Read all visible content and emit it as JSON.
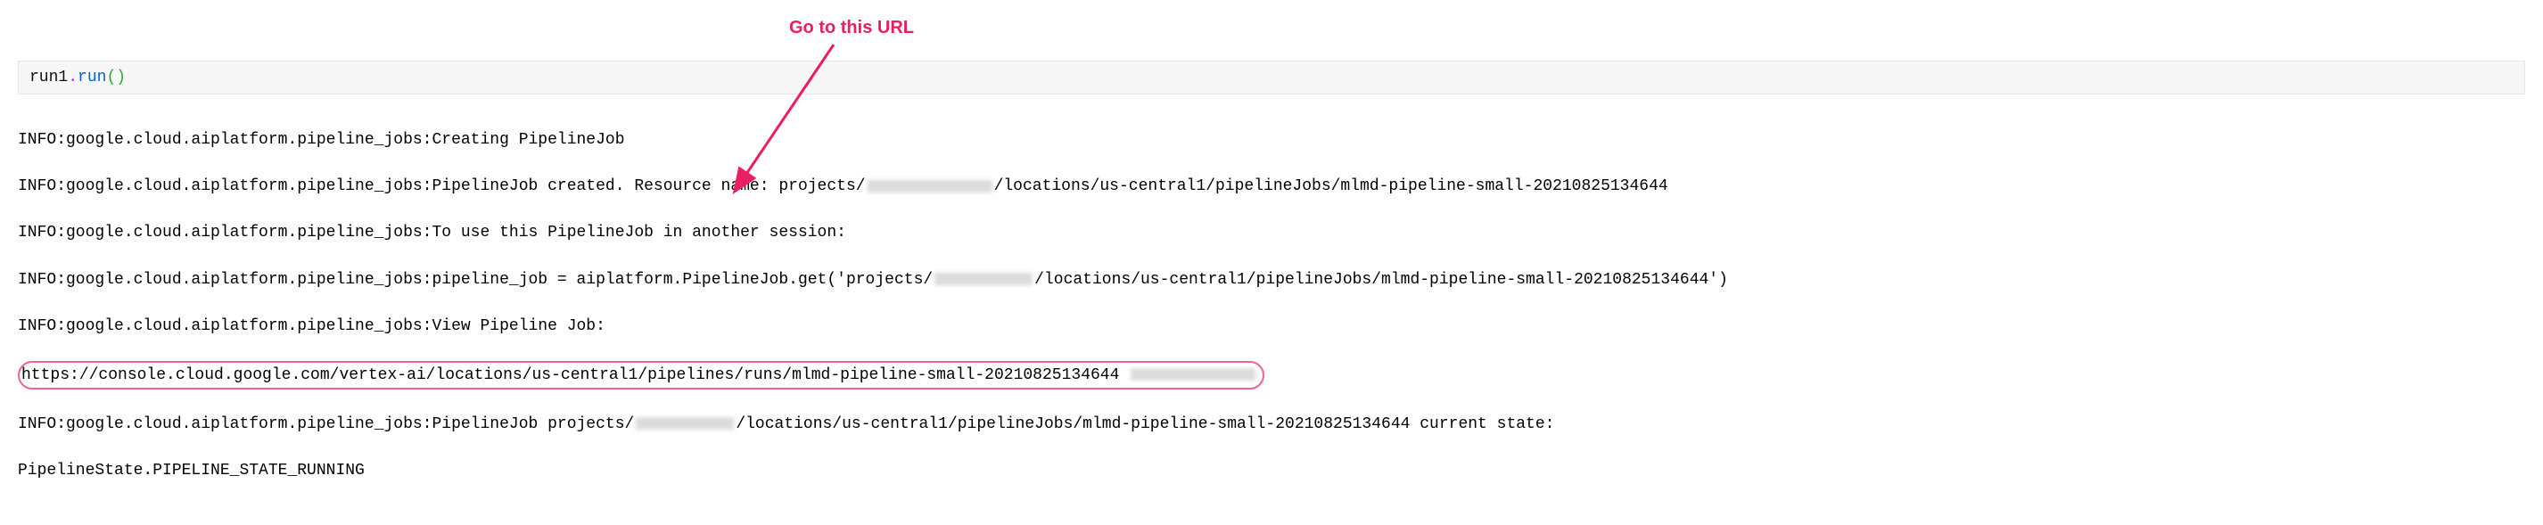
{
  "annotation": {
    "label": "Go to this URL"
  },
  "code": {
    "object": "run1",
    "dot": ".",
    "method": "run",
    "parens": "()"
  },
  "log": {
    "line1": "INFO:google.cloud.aiplatform.pipeline_jobs:Creating PipelineJob",
    "line2a": "INFO:google.cloud.aiplatform.pipeline_jobs:PipelineJob created. Resource name: projects/",
    "line2b": "/locations/us-central1/pipelineJobs/mlmd-pipeline-small-20210825134644",
    "line3": "INFO:google.cloud.aiplatform.pipeline_jobs:To use this PipelineJob in another session:",
    "line4a": "INFO:google.cloud.aiplatform.pipeline_jobs:pipeline_job = aiplatform.PipelineJob.get('projects/",
    "line4b": "/locations/us-central1/pipelineJobs/mlmd-pipeline-small-20210825134644')",
    "line5": "INFO:google.cloud.aiplatform.pipeline_jobs:View Pipeline Job:",
    "line6": "https://console.cloud.google.com/vertex-ai/locations/us-central1/pipelines/runs/mlmd-pipeline-small-20210825134644",
    "line7a": "INFO:google.cloud.aiplatform.pipeline_jobs:PipelineJob projects/",
    "line7b": "/locations/us-central1/pipelineJobs/mlmd-pipeline-small-20210825134644 current state:",
    "line8": "PipelineState.PIPELINE_STATE_RUNNING"
  }
}
